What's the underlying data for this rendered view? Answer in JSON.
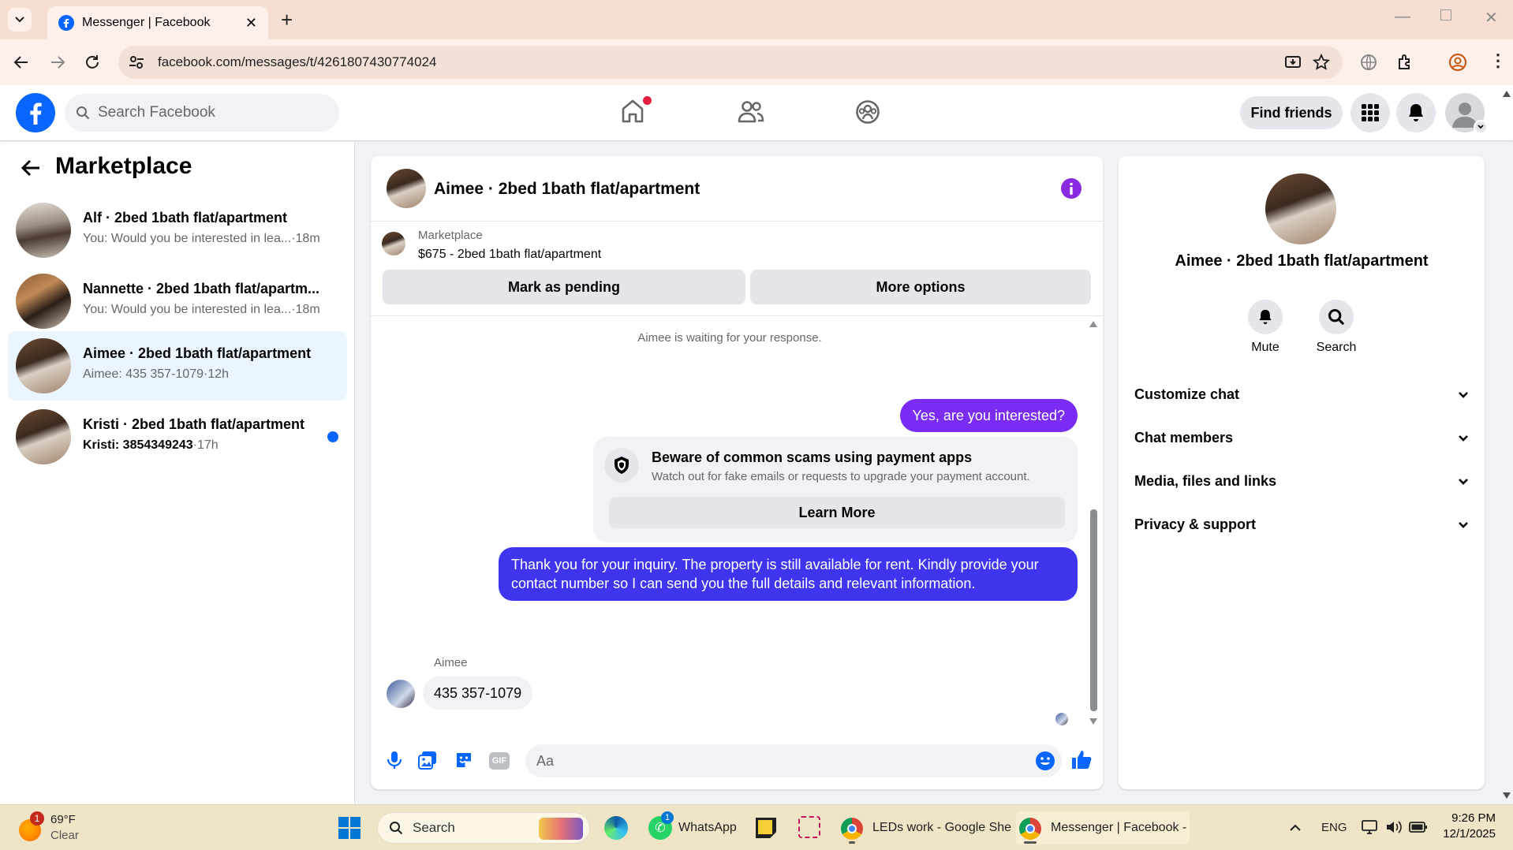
{
  "browser": {
    "tab_title": "Messenger | Facebook",
    "url": "facebook.com/messages/t/4261807430774024"
  },
  "fb_header": {
    "search_placeholder": "Search Facebook",
    "find_friends": "Find friends"
  },
  "left_panel": {
    "title": "Marketplace",
    "conversations": [
      {
        "title": "Alf · 2bed 1bath flat/apartment",
        "preview": "You: Would you be interested in lea...",
        "time": "·18m"
      },
      {
        "title": "Nannette · 2bed 1bath flat/apartm...",
        "preview": "You: Would you be interested in lea...",
        "time": "·18m"
      },
      {
        "title": "Aimee · 2bed 1bath flat/apartment",
        "preview": "Aimee: 435 357-1079",
        "time": "·12h"
      },
      {
        "title": "Kristi · 2bed 1bath flat/apartment",
        "preview": "Kristi: 3854349243",
        "time": "·17h"
      }
    ]
  },
  "chat": {
    "header_title": "Aimee · 2bed 1bath flat/apartment",
    "listing_source": "Marketplace",
    "listing_info": "$675 - 2bed 1bath flat/apartment",
    "mark_pending": "Mark as pending",
    "more_options": "More options",
    "waiting_note": "Aimee is waiting for your response.",
    "msg_sent_1": "Yes, are you interested?",
    "scam_title": "Beware of common scams using payment apps",
    "scam_body": "Watch out for fake emails or requests to upgrade your payment account.",
    "learn_more": "Learn More",
    "msg_sent_2": "Thank you for your inquiry. The property is still available for rent. Kindly provide your contact number so I can send you the full details and relevant information.",
    "sender_name": "Aimee",
    "msg_received": "435 357-1079",
    "composer_placeholder": "Aa"
  },
  "right_panel": {
    "name": "Aimee · 2bed 1bath flat/apartment",
    "mute": "Mute",
    "search": "Search",
    "sections": [
      "Customize chat",
      "Chat members",
      "Media, files and links",
      "Privacy & support"
    ]
  },
  "taskbar": {
    "weather_temp": "69°F",
    "weather_cond": "Clear",
    "weather_badge": "1",
    "search": "Search",
    "whatsapp": "WhatsApp",
    "whatsapp_badge": "1",
    "chrome_app1": "LEDs work - Google She",
    "chrome_app2": "Messenger | Facebook -",
    "lang": "ENG",
    "time": "9:26 PM",
    "date": "12/1/2025"
  },
  "colors": {
    "fb_blue": "#0866ff",
    "bubble_purple": "#7a2cf4",
    "bubble_blue": "#3f35ee",
    "unread_dot": "#0866ff"
  }
}
